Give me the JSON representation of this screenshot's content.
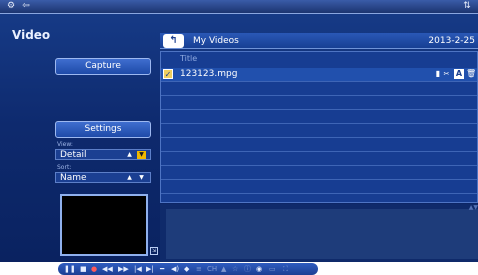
{
  "titlebar": {
    "left_icon_1": "gear-icon",
    "left_icon_2": "back-icon",
    "right_icon": "sync-icon"
  },
  "sidebar": {
    "heading": "Video",
    "capture_label": "Capture",
    "settings_label": "Settings",
    "view_label": "View:",
    "view_value": "Detail",
    "sort_label": "Sort:",
    "sort_value": "Name"
  },
  "pathbar": {
    "folder": "My Videos",
    "date": "2013-2-25"
  },
  "list": {
    "column_header": "Title",
    "rows": [
      {
        "name": "123123.mpg",
        "checked": true
      }
    ]
  },
  "colors": {
    "accent": "#f0b800",
    "background": "#0e2a6e",
    "button": "#2d5ec0"
  },
  "icons": {
    "edit": "edit-icon",
    "scissors": "scissors-icon",
    "text": "text-icon",
    "trash": "trash-icon"
  }
}
